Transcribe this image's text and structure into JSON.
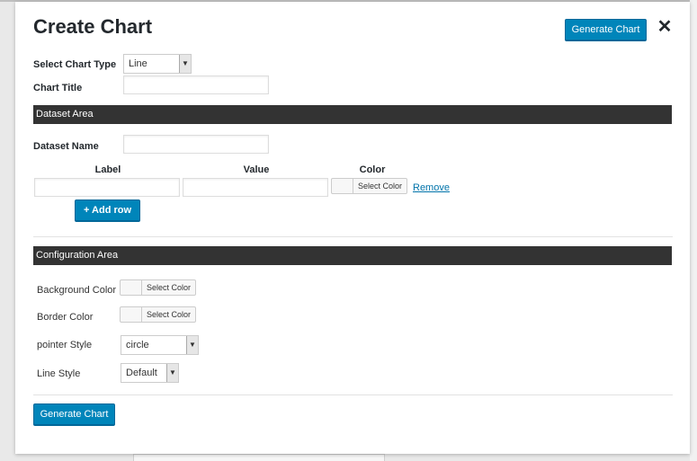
{
  "modal": {
    "title": "Create Chart",
    "generate_top_label": "Generate Chart",
    "close_glyph": "✕",
    "generate_bottom_label": "Generate Chart"
  },
  "form": {
    "chart_type_label": "Select Chart Type",
    "chart_type_value": "Line",
    "chart_title_label": "Chart Title",
    "chart_title_value": ""
  },
  "dataset": {
    "section_title": "Dataset Area",
    "name_label": "Dataset Name",
    "name_value": "",
    "columns": [
      "Label",
      "Value",
      "Color"
    ],
    "row": {
      "label_value": "",
      "value_value": "",
      "color_button_label": "Select Color",
      "remove_label": "Remove"
    },
    "add_row_label": "+ Add row"
  },
  "config": {
    "section_title": "Configuration Area",
    "background_color_label": "Background Color",
    "background_color_button": "Select Color",
    "border_color_label": "Border Color",
    "border_color_button": "Select Color",
    "pointer_style_label": "pointer Style",
    "pointer_style_value": "circle",
    "line_style_label": "Line Style",
    "line_style_value": "Default"
  },
  "colors": {
    "primary": "#0085ba",
    "section_bar": "#333333",
    "link": "#0073aa"
  },
  "icons": {
    "dropdown": "chevron-down-icon",
    "close": "close-icon"
  }
}
